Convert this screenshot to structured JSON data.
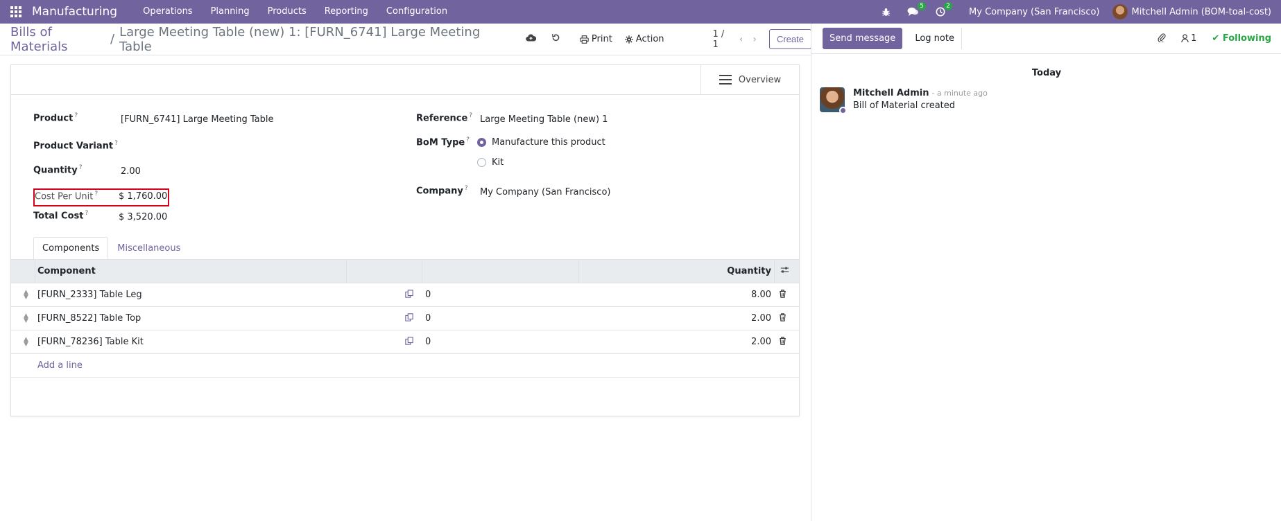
{
  "navbar": {
    "app_name": "Manufacturing",
    "menu": [
      "Operations",
      "Planning",
      "Products",
      "Reporting",
      "Configuration"
    ],
    "messages_count": "5",
    "activities_count": "2",
    "company": "My Company (San Francisco)",
    "user": "Mitchell Admin (BOM-toal-cost)"
  },
  "control_panel": {
    "breadcrumb_parent": "Bills of Materials",
    "breadcrumb_sep": "/",
    "breadcrumb_current": "Large Meeting Table (new) 1: [FURN_6741] Large Meeting Table",
    "print_label": "Print",
    "action_label": "Action",
    "pager": "1 / 1",
    "create_label": "Create"
  },
  "form": {
    "overview_label": "Overview",
    "product_label": "Product",
    "product_value": "[FURN_6741] Large Meeting Table",
    "variant_label": "Product Variant",
    "quantity_label": "Quantity",
    "quantity_value": "2.00",
    "cost_per_unit_label": "Cost Per Unit",
    "cost_per_unit_value": "$ 1,760.00",
    "total_cost_label": "Total Cost",
    "total_cost_value": "$ 3,520.00",
    "reference_label": "Reference",
    "reference_value": "Large Meeting Table (new) 1",
    "bom_type_label": "BoM Type",
    "bom_type_options": [
      "Manufacture this product",
      "Kit"
    ],
    "company_label": "Company",
    "company_value": "My Company (San Francisco)",
    "help_mark": "?"
  },
  "tabs": [
    "Components",
    "Miscellaneous"
  ],
  "components": {
    "header_component": "Component",
    "header_quantity": "Quantity",
    "rows": [
      {
        "name": "[FURN_2333] Table Leg",
        "zero": "0",
        "qty": "8.00"
      },
      {
        "name": "[FURN_8522] Table Top",
        "zero": "0",
        "qty": "2.00"
      },
      {
        "name": "[FURN_78236] Table Kit",
        "zero": "0",
        "qty": "2.00"
      }
    ],
    "add_line": "Add a line"
  },
  "chatter": {
    "send_message": "Send message",
    "log_note": "Log note",
    "followers_count": "1",
    "following": "Following",
    "today": "Today",
    "message_author": "Mitchell Admin",
    "message_date": "- a minute ago",
    "message_text": "Bill of Material created"
  },
  "colors": {
    "brand": "#71639e",
    "highlight_border": "#d9001b",
    "following": "#28a745"
  }
}
